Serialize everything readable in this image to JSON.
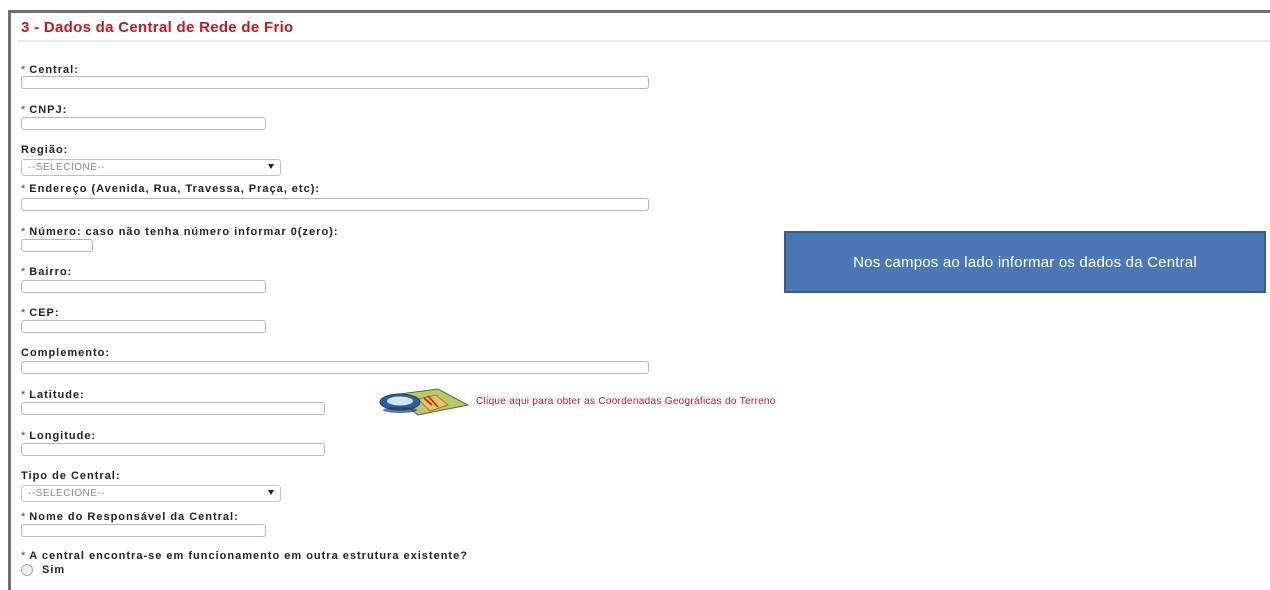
{
  "section": {
    "title": "3 - Dados da Central de Rede de Frio"
  },
  "fields": {
    "central": {
      "label": "Central:",
      "required": "*",
      "value": ""
    },
    "cnpj": {
      "label": "CNPJ:",
      "required": "*",
      "value": ""
    },
    "regiao": {
      "label": "Região:",
      "selected": "--SELECIONE--"
    },
    "endereco": {
      "label": "Endereço (Avenida, Rua, Travessa, Praça, etc):",
      "required": "*",
      "value": ""
    },
    "numero": {
      "label": "Número: caso não tenha número informar 0(zero):",
      "required": "*",
      "value": ""
    },
    "bairro": {
      "label": "Bairro:",
      "required": "*",
      "value": ""
    },
    "cep": {
      "label": "CEP:",
      "required": "*",
      "value": ""
    },
    "complemento": {
      "label": "Complemento:",
      "value": ""
    },
    "latitude": {
      "label": "Latitude:",
      "required": "*",
      "value": ""
    },
    "longitude": {
      "label": "Longitude:",
      "required": "*",
      "value": ""
    },
    "tipo_central": {
      "label": "Tipo de Central:",
      "selected": "--SELECIONE--"
    },
    "responsavel": {
      "label": "Nome do Responsável da Central:",
      "required": "*",
      "value": ""
    },
    "funcionamento": {
      "label": "A central encontra-se em funcionamento em outra estrutura existente?",
      "required": "*",
      "option_sim": "Sim"
    }
  },
  "map": {
    "icon": "map-icon",
    "link_text": "Clique aqui para obter as Coordenadas Geográficas do Terreno"
  },
  "callout": {
    "text": "Nos campos ao lado informar os dados da Central"
  },
  "colors": {
    "title_red": "#c0191f",
    "callout_blue": "#4b78b5"
  }
}
